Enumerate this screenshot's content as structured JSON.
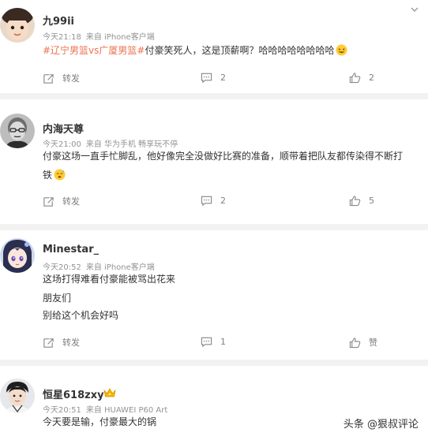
{
  "comments": [
    {
      "username": "九99ii",
      "time": "今天21:18",
      "source": "来自 iPhone客户端",
      "text": {
        "tag1": "#辽宁男篮vs广厦男篮#",
        "body": "付豪笑死人，这是顶薪啊？哈哈哈哈哈哈哈哈"
      },
      "emoji": "laughing-emoji",
      "actions": {
        "repost": "转发",
        "comments": "2",
        "likes": "2"
      }
    },
    {
      "username": "内海天尊",
      "time": "今天21:00",
      "source": "来自 华为手机 畅享玩不停",
      "text": {
        "line1": "付豪这场一直手忙脚乱，他好像完全没做好比赛的准备，顺带着把队友都传染得不断打",
        "line2": "铁"
      },
      "emoji": "sweat-emoji",
      "actions": {
        "repost": "转发",
        "comments": "2",
        "likes": "5"
      }
    },
    {
      "username": "Minestar_",
      "time": "今天20:52",
      "source": "来自 iPhone客户端",
      "text": {
        "line1": "这场打得难看付豪能被骂出花来",
        "line2": "朋友们",
        "line3": "别给这个机会好吗"
      },
      "actions": {
        "repost": "转发",
        "comments": "1",
        "likes": "赞"
      }
    },
    {
      "username": "恒星618zxy",
      "time": "今天20:51",
      "source": "来自 HUAWEI P60 Art",
      "badge": "crown-icon",
      "text": {
        "line1": "今天要是输，付豪最大的锅"
      }
    }
  ],
  "watermark": "头条 @狠叔评论",
  "colors": {
    "tag": "#eb7350",
    "meta": "#939393",
    "background": "#f2f2f2"
  }
}
